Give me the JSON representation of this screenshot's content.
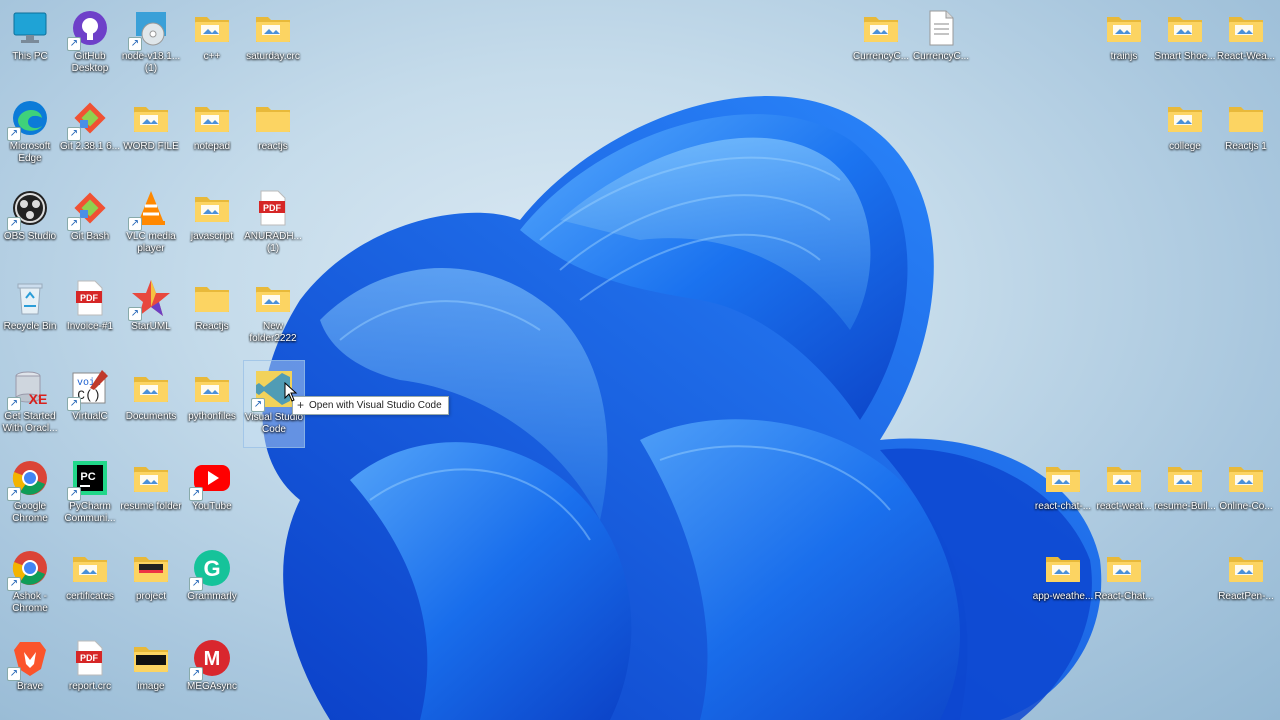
{
  "icons": [
    {
      "label": "This PC",
      "type": "monitor"
    },
    {
      "label": "GitHub Desktop",
      "type": "github",
      "shortcut": true
    },
    {
      "label": "node-v18.1...(1)",
      "type": "disc",
      "shortcut": true
    },
    {
      "label": "c++",
      "type": "folder"
    },
    {
      "label": "saturday.crc",
      "type": "folder"
    },
    {
      "label": "Microsoft Edge",
      "type": "edge",
      "shortcut": true
    },
    {
      "label": "Git 2.38.1 6...",
      "type": "git",
      "shortcut": true
    },
    {
      "label": "WORD FILE",
      "type": "folder"
    },
    {
      "label": "notepad",
      "type": "folder"
    },
    {
      "label": "reactjs",
      "type": "folder-plain"
    },
    {
      "label": "OBS Studio",
      "type": "obs",
      "shortcut": true
    },
    {
      "label": "Git Bash",
      "type": "git",
      "shortcut": true
    },
    {
      "label": "VLC media player",
      "type": "vlc",
      "shortcut": true
    },
    {
      "label": "javascript",
      "type": "folder"
    },
    {
      "label": "ANURADH...(1)",
      "type": "pdf"
    },
    {
      "label": "Recycle Bin",
      "type": "recycle"
    },
    {
      "label": "Invoice-#1",
      "type": "pdf"
    },
    {
      "label": "StarUML",
      "type": "star",
      "shortcut": true
    },
    {
      "label": "Reactjs",
      "type": "folder-plain"
    },
    {
      "label": "New folder2222",
      "type": "folder"
    },
    {
      "label": "Get Started With Oracl...",
      "type": "oracle",
      "shortcut": true
    },
    {
      "label": "VirtualC",
      "type": "virtualc",
      "shortcut": true
    },
    {
      "label": "Documents",
      "type": "folder"
    },
    {
      "label": "pythonfiles",
      "type": "folder"
    },
    {
      "label": "Visual Studio Code",
      "type": "vscode",
      "shortcut": true
    },
    {
      "label": "Google Chrome",
      "type": "chrome",
      "shortcut": true
    },
    {
      "label": "PyCharm Communi...",
      "type": "pycharm",
      "shortcut": true
    },
    {
      "label": "resume folder",
      "type": "folder"
    },
    {
      "label": "YouTube",
      "type": "youtube",
      "shortcut": true
    },
    {
      "label": "Ashok - Chrome",
      "type": "chrome",
      "shortcut": true
    },
    {
      "label": "certificates",
      "type": "folder"
    },
    {
      "label": "project",
      "type": "folder-dark"
    },
    {
      "label": "Grammarly",
      "type": "grammarly",
      "shortcut": true
    },
    {
      "label": "Brave",
      "type": "brave",
      "shortcut": true
    },
    {
      "label": "report.crc",
      "type": "pdf"
    },
    {
      "label": "image",
      "type": "folder-black"
    },
    {
      "label": "MEGAsync",
      "type": "mega",
      "shortcut": true
    },
    {
      "label": "CurrencyC...",
      "type": "folder"
    },
    {
      "label": "CurrencyC...",
      "type": "file"
    },
    {
      "label": "trainjs",
      "type": "folder"
    },
    {
      "label": "Smart Shoe...",
      "type": "folder"
    },
    {
      "label": "React-Wea...",
      "type": "folder"
    },
    {
      "label": "college",
      "type": "folder"
    },
    {
      "label": "Reactjs 1",
      "type": "folder-plain"
    },
    {
      "label": "react-chat-...",
      "type": "folder"
    },
    {
      "label": "react-weat...",
      "type": "folder"
    },
    {
      "label": "resume-Buil...",
      "type": "folder"
    },
    {
      "label": "Online-Co...",
      "type": "folder"
    },
    {
      "label": "app-weathe...",
      "type": "folder"
    },
    {
      "label": "React-Chat...",
      "type": "folder"
    },
    {
      "label": "ReactPen-...",
      "type": "folder"
    }
  ],
  "tooltip": {
    "text": "Open with Visual Studio Code",
    "symbol": "+"
  }
}
